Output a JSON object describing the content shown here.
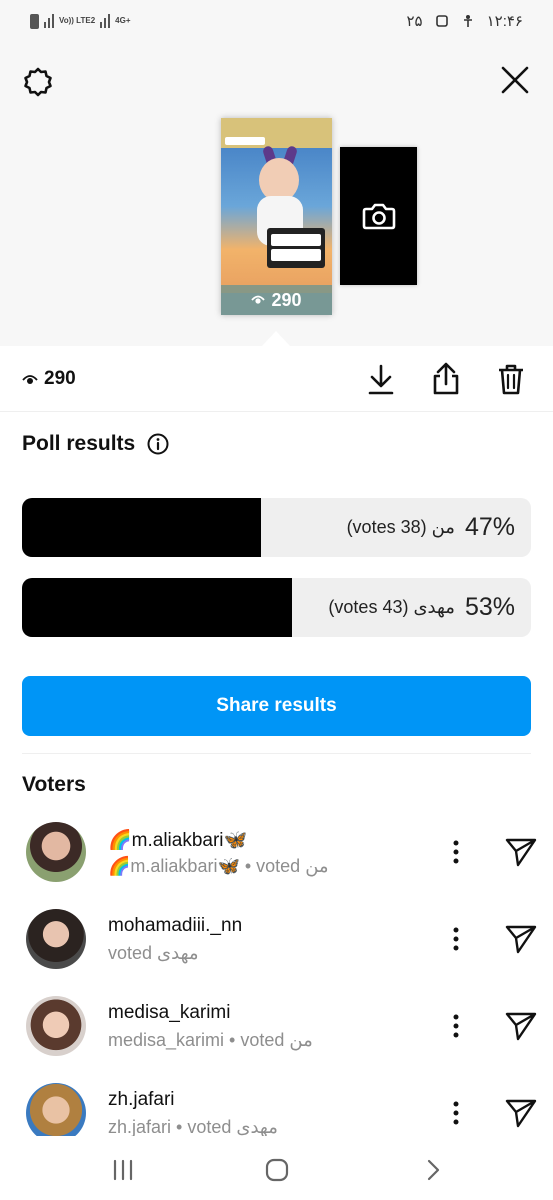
{
  "status_bar": {
    "left_network_label": "Vo)) LTE2",
    "left_network_label_2": "4G+",
    "right_number": "۲۵",
    "time": "۱۲:۴۶"
  },
  "preview": {
    "views": "290",
    "camera_icon": "camera-icon",
    "settings_icon": "gear-icon",
    "close_icon": "close-icon"
  },
  "actions": {
    "views": "290",
    "icons": [
      "download-icon",
      "share-icon",
      "trash-icon"
    ]
  },
  "poll": {
    "title": "Poll results",
    "info_icon": "info-icon",
    "options": [
      {
        "text": "(votes 38) من",
        "percent_label": "47%",
        "percent": 47
      },
      {
        "text": "(votes 43) مهدی",
        "percent_label": "53%",
        "percent": 53
      }
    ],
    "share_label": "Share results",
    "colors": {
      "bar_fill": "#000000",
      "bar_track": "#efefef",
      "share_button": "#0095f6"
    }
  },
  "voters": {
    "title": "Voters",
    "items": [
      {
        "name": "🌈m.aliakbari🦋",
        "sub": "🌈m.aliakbari🦋 • voted من"
      },
      {
        "name": "mohamadiii._nn",
        "sub": "voted مهدی"
      },
      {
        "name": "medisa_karimi",
        "sub": "medisa_karimi • voted من"
      },
      {
        "name": "zh.jafari",
        "sub": "zh.jafari • voted مهدی"
      }
    ]
  },
  "nav": {
    "icons": [
      "recents-icon",
      "home-icon",
      "back-icon"
    ]
  }
}
